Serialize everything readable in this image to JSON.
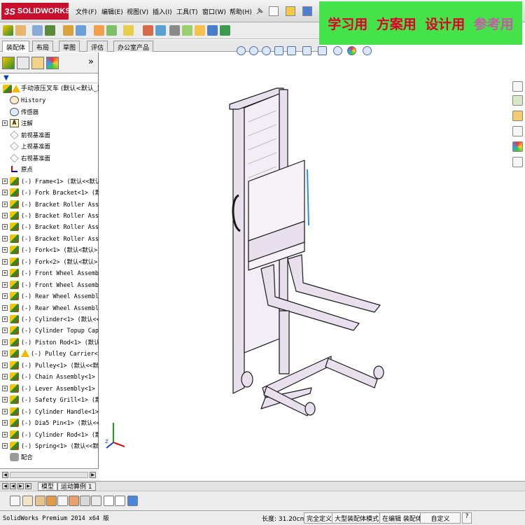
{
  "app": {
    "logo": "SOLIDWORKS",
    "logo_prefix": "3S",
    "menus": [
      "文件(F)",
      "编辑(E)",
      "视图(V)",
      "插入(I)",
      "工具(T)",
      "窗口(W)",
      "帮助(H)"
    ]
  },
  "promo": [
    "学习用",
    "方案用",
    "设计用",
    "参考用"
  ],
  "command_tabs": [
    "装配体",
    "布局",
    "草图",
    "评估",
    "办公室产品"
  ],
  "active_command_tab": "装配体",
  "tree": {
    "root": "手动液压叉车  (默认<默认_显",
    "items": [
      {
        "label": "History",
        "icon": "history-icon",
        "expand": false
      },
      {
        "label": "传感器",
        "icon": "sensor-icon",
        "expand": false
      },
      {
        "label": "注解",
        "icon": "annotation-icon",
        "expand": true
      },
      {
        "label": "前视基准面",
        "icon": "plane-icon",
        "expand": false
      },
      {
        "label": "上视基准面",
        "icon": "plane-icon",
        "expand": false
      },
      {
        "label": "右视基准面",
        "icon": "plane-icon",
        "expand": false
      },
      {
        "label": "原点",
        "icon": "origin-icon",
        "expand": false
      },
      {
        "label": "(-) Frame<1> (默认<<默认>_",
        "icon": "part-icon",
        "expand": true
      },
      {
        "label": "(-) Fork Bracket<1> (默认",
        "icon": "part-icon",
        "expand": true
      },
      {
        "label": "(-) Bracket Roller Assembl",
        "icon": "part-icon",
        "expand": true
      },
      {
        "label": "(-) Bracket Roller Assembl",
        "icon": "part-icon",
        "expand": true
      },
      {
        "label": "(-) Bracket Roller Assembl",
        "icon": "part-icon",
        "expand": true
      },
      {
        "label": "(-) Bracket Roller Assembl",
        "icon": "part-icon",
        "expand": true
      },
      {
        "label": "(-) Fork<1> (默认<默认>_显",
        "icon": "part-icon",
        "expand": true
      },
      {
        "label": "(-) Fork<2> (默认<默认>_显",
        "icon": "part-icon",
        "expand": true
      },
      {
        "label": "(-) Front Wheel Assembly<1",
        "icon": "part-icon",
        "expand": true
      },
      {
        "label": "(-) Front Wheel Assembly<2",
        "icon": "part-icon",
        "expand": true
      },
      {
        "label": "(-) Rear Wheel Assembly<1>",
        "icon": "part-icon",
        "expand": true
      },
      {
        "label": "(-) Rear Wheel Assembly<2>",
        "icon": "part-icon",
        "expand": true
      },
      {
        "label": "(-) Cylinder<1> (默认<<默",
        "icon": "part-icon",
        "expand": true
      },
      {
        "label": "(-) Cylinder Topup Cap<1>",
        "icon": "part-icon",
        "expand": true
      },
      {
        "label": "(-) Piston Rod<1> (默认<<",
        "icon": "part-icon",
        "expand": true
      },
      {
        "label": "(-) Pulley Carrier<1>",
        "icon": "part-warning-icon",
        "expand": true
      },
      {
        "label": "(-) Pulley<1> (默认<<默认",
        "icon": "part-icon",
        "expand": true
      },
      {
        "label": "(-) Chain Assembly<1> (默",
        "icon": "part-icon",
        "expand": true
      },
      {
        "label": "(-) Lever Assembly<1> (默",
        "icon": "part-icon",
        "expand": true
      },
      {
        "label": "(-) Safety Grill<1> (默认",
        "icon": "part-icon",
        "expand": true
      },
      {
        "label": "(-) Cylinder Handle<1> (默",
        "icon": "part-icon",
        "expand": true
      },
      {
        "label": "(-) Dia5 Pin<1> (默认<<默",
        "icon": "part-icon",
        "expand": true
      },
      {
        "label": "(-) Cylinder Rod<1> (默认",
        "icon": "part-icon",
        "expand": true
      },
      {
        "label": "(-) Spring<1> (默认<<默认",
        "icon": "part-icon",
        "expand": true
      },
      {
        "label": "配合",
        "icon": "mates-icon",
        "expand": false
      }
    ]
  },
  "bottom_tabs": [
    "模型",
    "运动算例 1"
  ],
  "status": {
    "app_version": "SolidWorks Premium 2014 x64 版",
    "length": "长度: 31.20cm",
    "definition": "完全定义",
    "large_assembly": "大型装配体模式",
    "editing": "在编辑 装配体",
    "custom": "自定义"
  },
  "colors": {
    "promo_bg": "#44e34a",
    "promo_text": "#e0002a",
    "model_fill": "#e9e0ee",
    "model_line": "#1a1a1a",
    "accent_blue": "#2a8ef0"
  }
}
